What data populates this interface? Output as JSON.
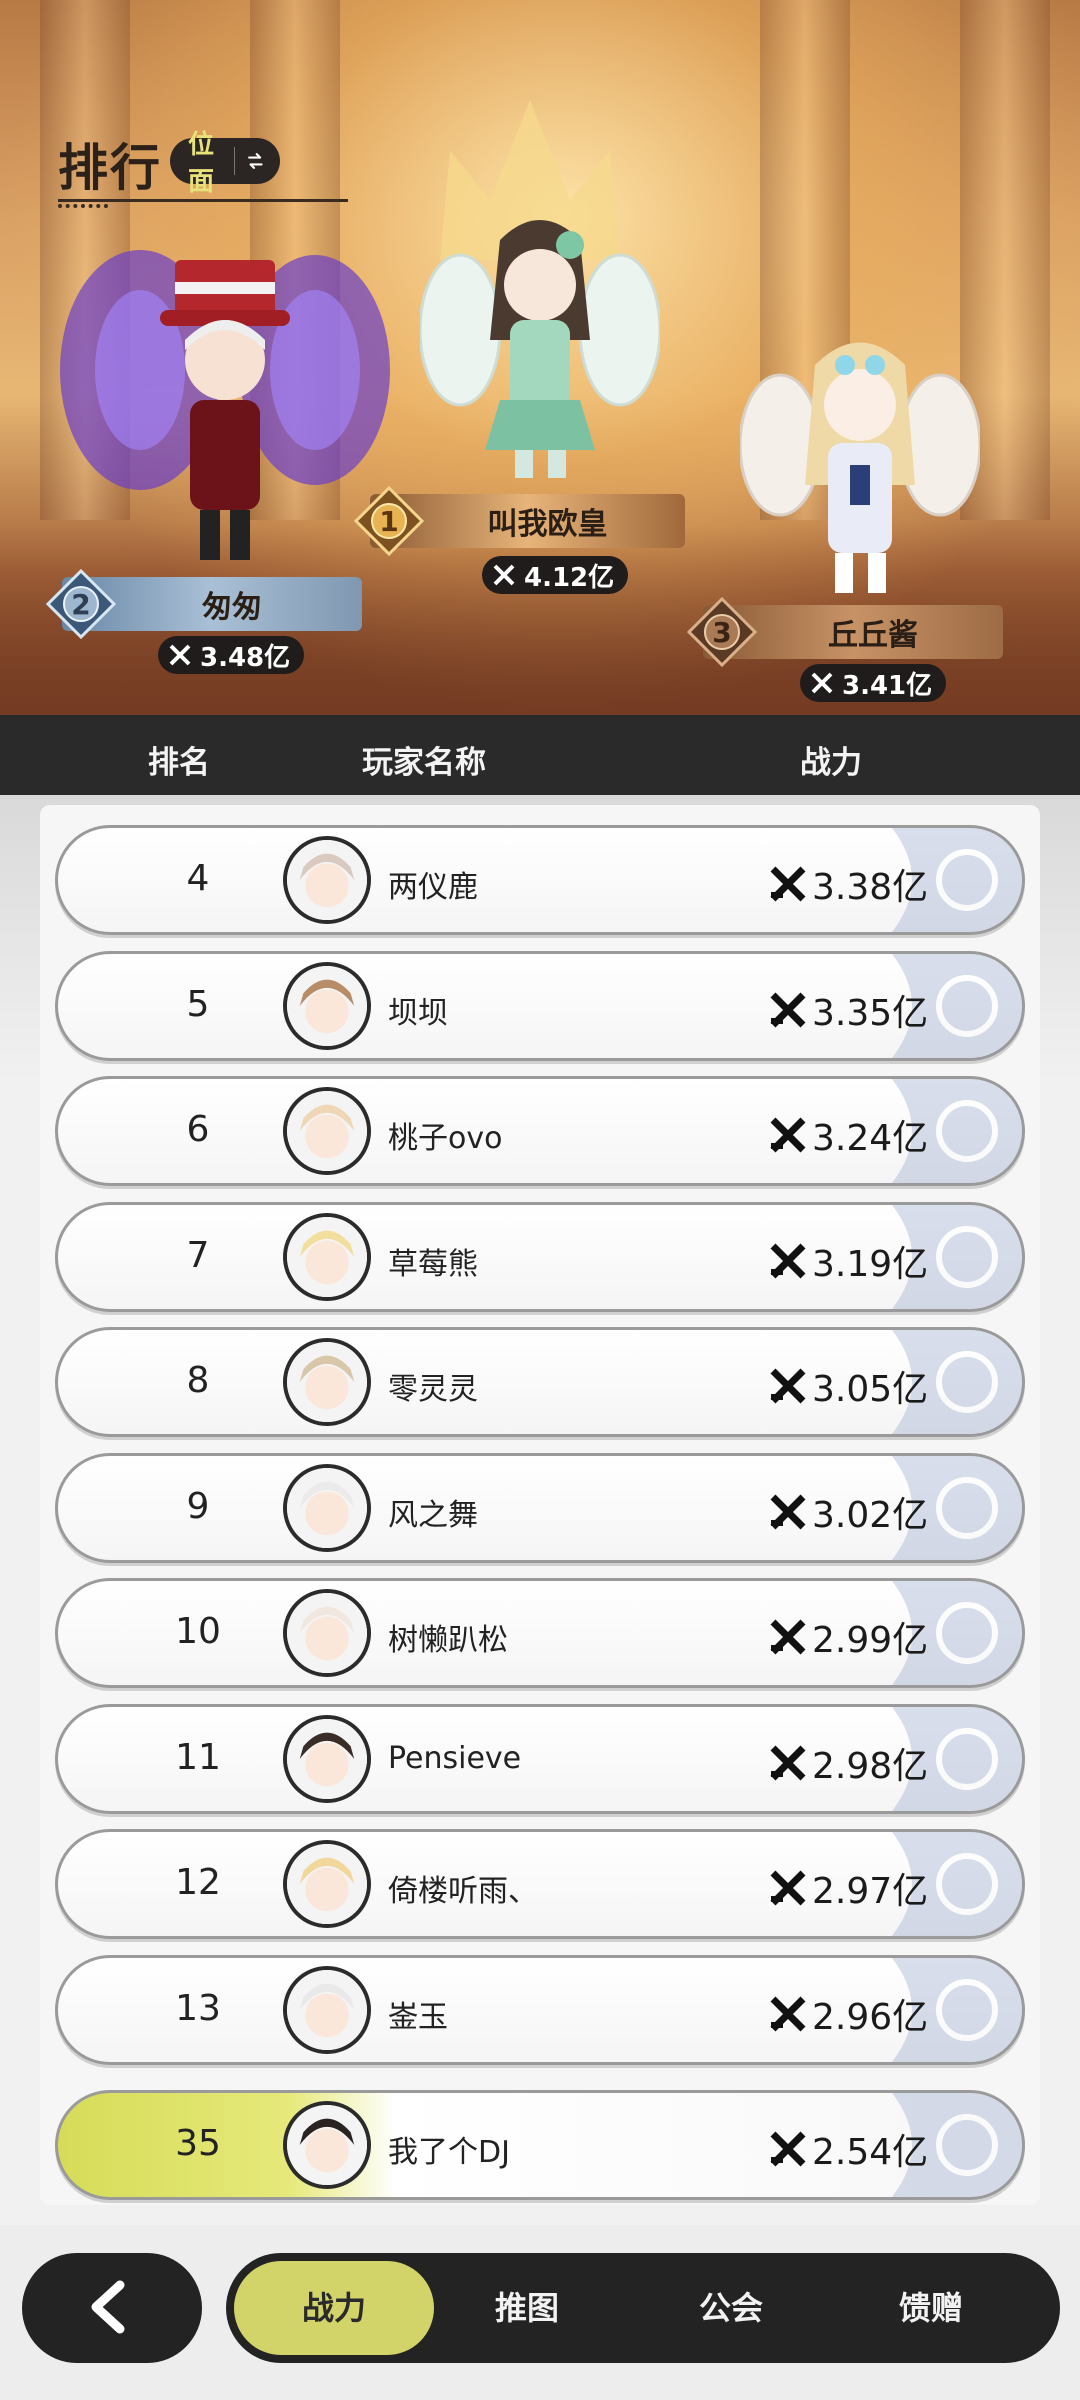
{
  "header": {
    "title": "排行",
    "realm_toggle_label": "位面"
  },
  "podium": [
    {
      "rank": "1",
      "name": "叫我欧皇",
      "power": "4.12亿"
    },
    {
      "rank": "2",
      "name": "匆匆",
      "power": "3.48亿"
    },
    {
      "rank": "3",
      "name": "丘丘酱",
      "power": "3.41亿"
    }
  ],
  "table_header": {
    "rank": "排名",
    "player": "玩家名称",
    "power": "战力"
  },
  "rows": [
    {
      "rank": "4",
      "name": "两仪鹿",
      "power": "3.38亿"
    },
    {
      "rank": "5",
      "name": "坝坝",
      "power": "3.35亿"
    },
    {
      "rank": "6",
      "name": "桃子ovo",
      "power": "3.24亿"
    },
    {
      "rank": "7",
      "name": "草莓熊",
      "power": "3.19亿"
    },
    {
      "rank": "8",
      "name": "零灵灵",
      "power": "3.05亿"
    },
    {
      "rank": "9",
      "name": "风之舞",
      "power": "3.02亿"
    },
    {
      "rank": "10",
      "name": "树懒趴松",
      "power": "2.99亿"
    },
    {
      "rank": "11",
      "name": "Pensieve",
      "power": "2.98亿"
    },
    {
      "rank": "12",
      "name": "倚楼听雨、",
      "power": "2.97亿"
    },
    {
      "rank": "13",
      "name": "崟玉",
      "power": "2.96亿"
    }
  ],
  "self_row": {
    "rank": "35",
    "name": "我了个DJ",
    "power": "2.54亿"
  },
  "tabs": [
    {
      "label": "战力",
      "active": true
    },
    {
      "label": "推图",
      "active": false
    },
    {
      "label": "公会",
      "active": false
    },
    {
      "label": "馈赠",
      "active": false
    }
  ],
  "icons": {
    "back": "back-arrow-icon",
    "swap": "swap-arrows-icon",
    "power": "crossed-swords-icon"
  },
  "colors": {
    "accent": "#d2d46a",
    "dark": "#232323",
    "realm_text": "#e7e27a"
  }
}
